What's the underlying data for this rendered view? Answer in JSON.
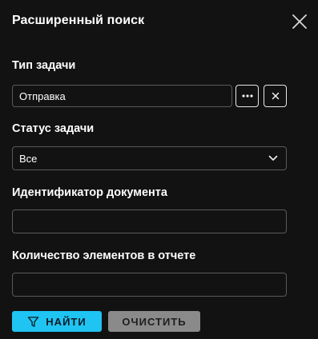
{
  "header": {
    "title": "Расширенный поиск",
    "close_icon": "close-icon"
  },
  "task_type": {
    "label": "Тип задачи",
    "value": "Отправка",
    "more_icon": "more-horizontal-icon",
    "clear_icon": "close-icon"
  },
  "task_status": {
    "label": "Статус задачи",
    "selected": "Все",
    "chevron_icon": "chevron-down-icon"
  },
  "document_id": {
    "label": "Идентификатор документа",
    "value": ""
  },
  "report_count": {
    "label": "Количество элементов в отчете",
    "value": ""
  },
  "actions": {
    "find_label": "НАЙТИ",
    "find_icon": "filter-icon",
    "clear_label": "ОЧИСТИТЬ"
  },
  "colors": {
    "background": "#121212",
    "accent": "#1fc4f2",
    "secondary_button": "#8a8a8a",
    "border": "#5a5a5a"
  }
}
